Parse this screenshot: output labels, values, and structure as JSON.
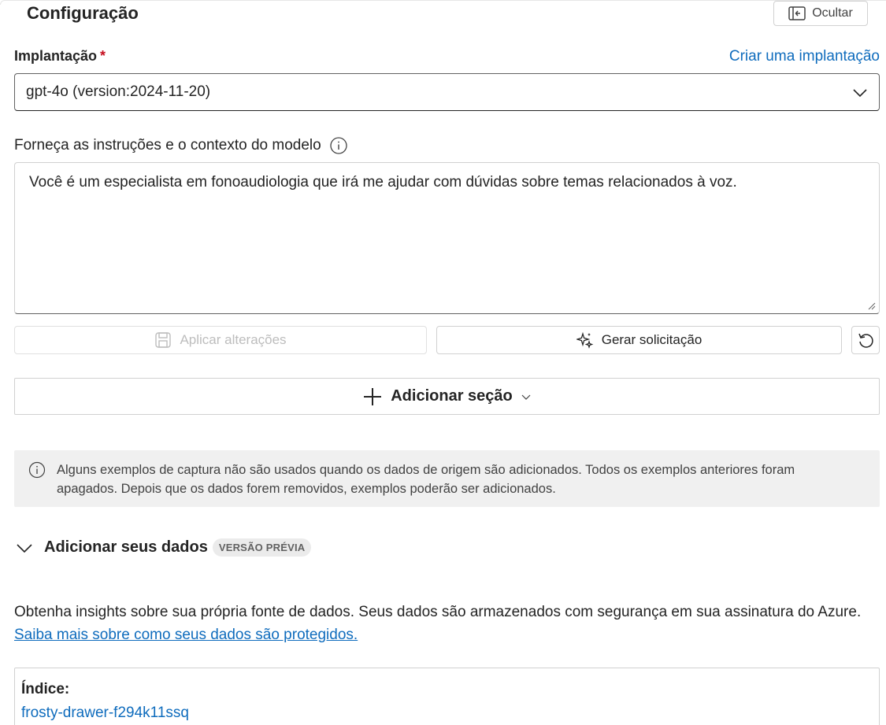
{
  "panel": {
    "title": "Configuração",
    "hide_label": "Ocultar"
  },
  "deployment": {
    "label": "Implantação",
    "required_mark": "*",
    "create_link": "Criar uma implantação",
    "selected": "gpt-4o (version:2024-11-20)"
  },
  "instructions": {
    "label": "Forneça as instruções e o contexto do modelo",
    "value": "Você é um especialista em fonoaudiologia que irá me ajudar com dúvidas sobre temas relacionados à voz."
  },
  "actions": {
    "apply_label": "Aplicar alterações",
    "generate_label": "Gerar solicitação"
  },
  "add_section": {
    "label": "Adicionar seção"
  },
  "info_message": "Alguns exemplos de captura não são usados quando os dados de origem são adicionados. Todos os exemplos anteriores foram apagados. Depois que os dados forem removidos, exemplos poderão ser adicionados.",
  "your_data": {
    "title": "Adicionar seus dados",
    "badge": "VERSÃO PRÉVIA",
    "description": "Obtenha insights sobre sua própria fonte de dados. Seus dados são armazenados com segurança em sua assinatura do Azure.",
    "learn_more": "Saiba mais sobre como seus dados são protegidos.",
    "index_label": "Índice:",
    "index_value": "frosty-drawer-f294k11ssq"
  },
  "icons": [
    "panel-collapse-icon",
    "chevron-down-icon",
    "info-icon",
    "save-icon",
    "sparkle-icon",
    "reset-icon",
    "plus-icon"
  ],
  "colors": {
    "link": "#0f6cbd",
    "required": "#c50f1f",
    "info_bg": "#f0f0f0"
  }
}
